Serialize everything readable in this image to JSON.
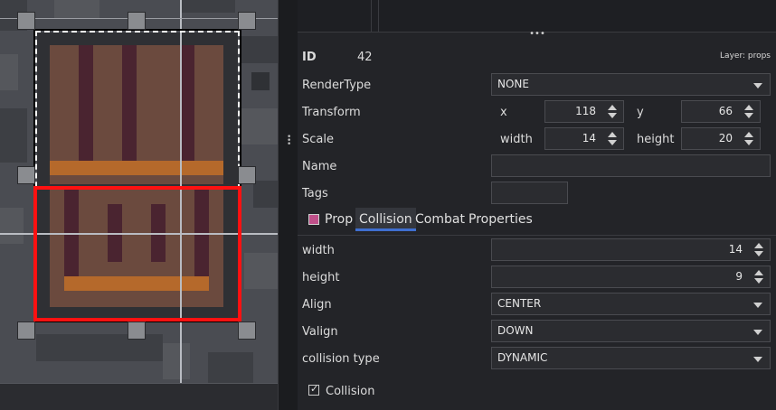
{
  "header": {
    "id_label": "ID",
    "id_value": "42",
    "layer_label": "Layer: props"
  },
  "properties": {
    "render_type": {
      "label": "RenderType",
      "value": "NONE"
    },
    "transform": {
      "label": "Transform",
      "x_label": "x",
      "x_value": "118",
      "y_label": "y",
      "y_value": "66"
    },
    "scale": {
      "label": "Scale",
      "width_label": "width",
      "width_value": "14",
      "height_label": "height",
      "height_value": "20"
    },
    "name": {
      "label": "Name",
      "value": ""
    },
    "tags": {
      "label": "Tags",
      "value": ""
    }
  },
  "tabs": [
    {
      "label": "Prop",
      "active": false
    },
    {
      "label": "Collision",
      "active": true
    },
    {
      "label": "Combat",
      "active": false
    },
    {
      "label": "Properties",
      "active": false
    }
  ],
  "collision": {
    "width": {
      "label": "width",
      "value": "14"
    },
    "height": {
      "label": "height",
      "value": "9"
    },
    "align": {
      "label": "Align",
      "value": "CENTER"
    },
    "valign": {
      "label": "Valign",
      "value": "DOWN"
    },
    "collision_type": {
      "label": "collision type",
      "value": "DYNAMIC"
    },
    "enabled": {
      "label": "Collision",
      "checked": true
    }
  },
  "colors": {
    "accent": "#3f6fd0",
    "collision_box": "#ff1111",
    "prop_tab_icon": "#c0508a"
  },
  "icons": {
    "checkmark": "✓",
    "grip_dots": "•••"
  }
}
